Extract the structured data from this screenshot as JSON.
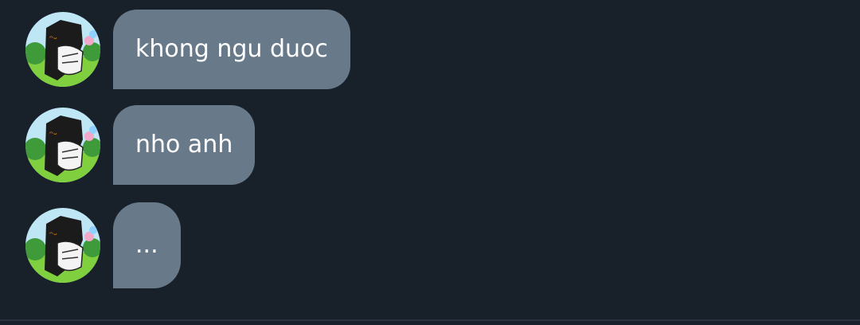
{
  "messages": [
    {
      "text": "khong ngu duoc"
    },
    {
      "text": "nho anh"
    },
    {
      "text": "..."
    }
  ],
  "colors": {
    "background": "#18202a",
    "bubble": "#687a89",
    "bubble_text": "#ffffff"
  }
}
